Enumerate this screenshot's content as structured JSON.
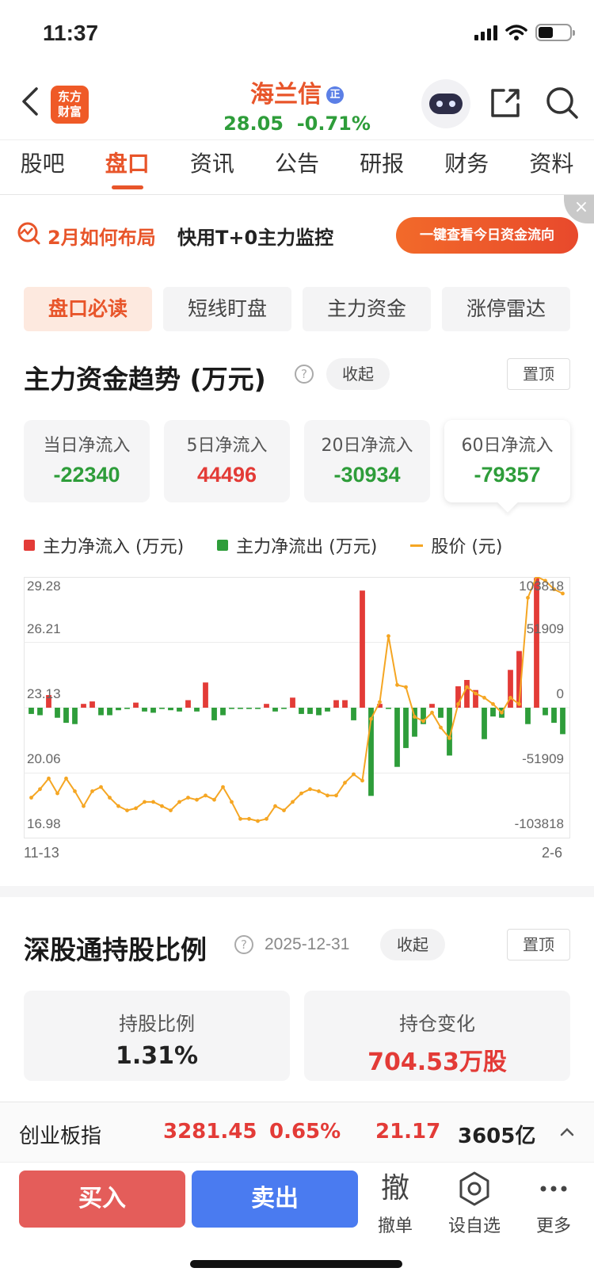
{
  "status_bar": {
    "time": "11:37"
  },
  "header": {
    "logo_line1": "东方",
    "logo_line2": "财富",
    "stock_name": "海兰信",
    "badge": "正",
    "price": "28.05",
    "change": "-0.71%"
  },
  "tabs": [
    "股吧",
    "盘口",
    "资讯",
    "公告",
    "研报",
    "财务",
    "资料"
  ],
  "banner": {
    "highlight": "2月如何布局",
    "text": "快用T+0主力监控",
    "button": "一键查看今日资金流向",
    "close": "×"
  },
  "subtabs": [
    "盘口必读",
    "短线盯盘",
    "主力资金",
    "涨停雷达"
  ],
  "fund_trend": {
    "title": "主力资金趋势 (万元)",
    "help": "?",
    "collapse": "收起",
    "pin": "置顶",
    "cards": [
      {
        "label": "当日净流入",
        "value": "-22340"
      },
      {
        "label": "5日净流入",
        "value": "44496"
      },
      {
        "label": "20日净流入",
        "value": "-30934"
      },
      {
        "label": "60日净流入",
        "value": "-79357"
      }
    ]
  },
  "colors": {
    "inflow": "#e33b37",
    "outflow": "#2e9d3a",
    "price": "#f5a623",
    "accent": "#e8552a"
  },
  "chart_data": {
    "type": "bar",
    "legend": [
      "主力净流入 (万元)",
      "主力净流出 (万元)",
      "股价 (元)"
    ],
    "left_ticks": [
      "29.28",
      "26.21",
      "23.13",
      "20.06",
      "16.98"
    ],
    "right_ticks": [
      "103818",
      "51909",
      "0",
      "-51909",
      "-103818"
    ],
    "y_left_range": [
      16.98,
      29.28
    ],
    "y_right_range": [
      -103818,
      103818
    ],
    "x_start": "11-13",
    "x_end": "2-6",
    "flows": [
      -5000,
      -6000,
      10000,
      -8000,
      -12000,
      -13000,
      3000,
      5000,
      -6000,
      -6000,
      -2000,
      -1000,
      4000,
      -3000,
      -4000,
      -1000,
      -2000,
      -3000,
      6000,
      -3000,
      20000,
      -10000,
      -6000,
      -1000,
      -1000,
      -1000,
      -1000,
      3000,
      -3000,
      -1000,
      8000,
      -5000,
      -5000,
      -6000,
      -3000,
      6000,
      6000,
      -10000,
      93000,
      -70000,
      3000,
      -1000,
      -47000,
      -32000,
      -23000,
      -13000,
      3000,
      -8000,
      -38000,
      17000,
      22000,
      14000,
      -25000,
      -7000,
      -8000,
      30000,
      45000,
      -13000,
      103000,
      -6000,
      -12000,
      -21000
    ],
    "price": [
      18.9,
      19.3,
      19.8,
      19.1,
      19.8,
      19.2,
      18.5,
      19.2,
      19.4,
      18.9,
      18.5,
      18.3,
      18.4,
      18.7,
      18.7,
      18.5,
      18.3,
      18.7,
      18.9,
      18.8,
      19.0,
      18.8,
      19.4,
      18.7,
      17.9,
      17.9,
      17.8,
      17.9,
      18.5,
      18.3,
      18.7,
      19.1,
      19.3,
      19.2,
      19.0,
      19.0,
      19.6,
      20.0,
      19.7,
      22.6,
      23.4,
      26.5,
      24.2,
      24.1,
      22.7,
      22.5,
      22.9,
      22.2,
      21.7,
      23.3,
      24.1,
      23.8,
      23.6,
      23.3,
      22.9,
      23.6,
      23.3,
      28.3,
      29.3,
      29.1,
      28.7,
      28.5
    ]
  },
  "connect": {
    "title": "深股通持股比例",
    "help": "?",
    "date": "2025-12-31",
    "collapse": "收起",
    "pin": "置顶",
    "ratio_label": "持股比例",
    "ratio_value": "1.31%",
    "change_label": "持仓变化",
    "change_value": "704.53万股"
  },
  "ticker": {
    "name": "创业板指",
    "value": "3281.45",
    "pct": "0.65%",
    "change": "21.17",
    "amount": "3605亿",
    "caret": "^"
  },
  "bottom": {
    "buy": "买入",
    "sell": "卖出",
    "cancel_glyph": "撤",
    "cancel_label": "撤单",
    "watch_label": "设自选",
    "more_label": "更多"
  }
}
